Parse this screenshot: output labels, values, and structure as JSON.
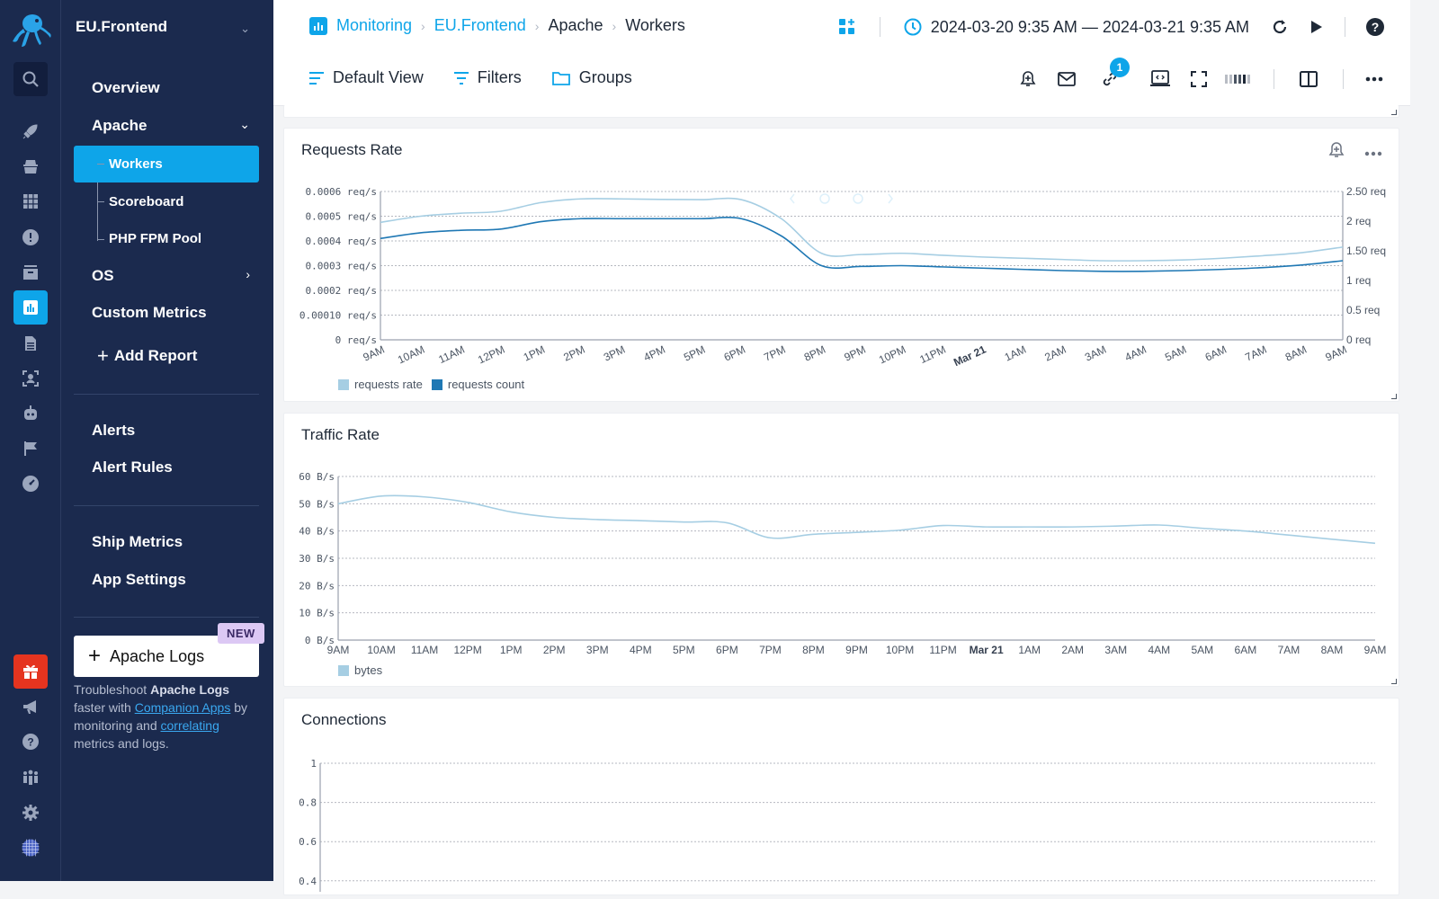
{
  "app": {
    "account": "EU.Frontend"
  },
  "rail": {
    "icons": [
      "logo-octopus",
      "search",
      "rocket",
      "spy",
      "apps-grid",
      "alert",
      "archive",
      "metrics",
      "document",
      "user-scan",
      "robot",
      "flag",
      "dashboard-gauge",
      "gift",
      "megaphone",
      "help",
      "team",
      "settings",
      "avatar-globe"
    ]
  },
  "nav": {
    "items": {
      "overview": "Overview",
      "apache": "Apache",
      "workers": "Workers",
      "scoreboard": "Scoreboard",
      "php_fpm_pool": "PHP FPM Pool",
      "os": "OS",
      "custom_metrics": "Custom Metrics",
      "add_report": "Add Report",
      "alerts": "Alerts",
      "alert_rules": "Alert Rules",
      "ship_metrics": "Ship Metrics",
      "app_settings": "App Settings"
    },
    "logs_button": "Apache Logs",
    "new_badge": "NEW",
    "promo": {
      "t1": "Troubleshoot ",
      "b1": "Apache Logs",
      "t2": " faster with ",
      "link1": "Companion Apps",
      "t3": " by monitoring and ",
      "link2": "correlating",
      "t4": " metrics and logs."
    }
  },
  "header": {
    "breadcrumb": [
      "Monitoring",
      "EU.Frontend",
      "Apache",
      "Workers"
    ],
    "time_range": "2024-03-20 9:35 AM — 2024-03-21 9:35 AM",
    "toolbar": {
      "default_view": "Default View",
      "filters": "Filters",
      "groups": "Groups"
    },
    "link_badge": "1"
  },
  "colors": {
    "accent": "#0ea5e9",
    "sidebar": "#1b2a4e",
    "series_light": "#a6cee3",
    "series_dark": "#1f78b4"
  },
  "chart_data": [
    {
      "type": "line",
      "title": "Requests Rate",
      "x": [
        "9AM",
        "10AM",
        "11AM",
        "12PM",
        "1PM",
        "2PM",
        "3PM",
        "4PM",
        "5PM",
        "6PM",
        "7PM",
        "8PM",
        "9PM",
        "10PM",
        "11PM",
        "Mar 21",
        "1AM",
        "2AM",
        "3AM",
        "4AM",
        "5AM",
        "6AM",
        "7AM",
        "8AM",
        "9AM"
      ],
      "yleft": {
        "ticks": [
          "0 req/s",
          "0.00010 req/s",
          "0.0002 req/s",
          "0.0003 req/s",
          "0.0004 req/s",
          "0.0005 req/s",
          "0.0006 req/s"
        ],
        "range": [
          0,
          0.0006
        ]
      },
      "yright": {
        "ticks": [
          "0 req",
          "0.5 req",
          "1 req",
          "1.50 req",
          "2 req",
          "2.50 req"
        ],
        "range": [
          0,
          2.5
        ]
      },
      "series": [
        {
          "name": "requests rate",
          "axis": "left",
          "values": [
            0.000475,
            0.0005,
            0.000512,
            0.00052,
            0.000555,
            0.00057,
            0.00057,
            0.000568,
            0.000567,
            0.000567,
            0.00049,
            0.00035,
            0.000345,
            0.00035,
            0.000342,
            0.000335,
            0.00033,
            0.000325,
            0.00032,
            0.00032,
            0.000323,
            0.00033,
            0.00034,
            0.000353,
            0.000375
          ]
        },
        {
          "name": "requests count",
          "axis": "left",
          "values": [
            0.00041,
            0.000433,
            0.000443,
            0.000448,
            0.000478,
            0.00049,
            0.00049,
            0.00049,
            0.00049,
            0.00049,
            0.00042,
            0.0003,
            0.000297,
            0.0003,
            0.000295,
            0.00029,
            0.000285,
            0.00028,
            0.000277,
            0.000277,
            0.00028,
            0.000285,
            0.000292,
            0.000303,
            0.00032
          ]
        }
      ],
      "legend": [
        "requests rate",
        "requests count"
      ],
      "grid": true,
      "legend_position": "bottom-left"
    },
    {
      "type": "line",
      "title": "Traffic Rate",
      "x": [
        "9AM",
        "10AM",
        "11AM",
        "12PM",
        "1PM",
        "2PM",
        "3PM",
        "4PM",
        "5PM",
        "6PM",
        "7PM",
        "8PM",
        "9PM",
        "10PM",
        "11PM",
        "Mar 21",
        "1AM",
        "2AM",
        "3AM",
        "4AM",
        "5AM",
        "6AM",
        "7AM",
        "8AM",
        "9AM"
      ],
      "yleft": {
        "ticks": [
          "0 B/s",
          "10 B/s",
          "20 B/s",
          "30 B/s",
          "40 B/s",
          "50 B/s",
          "60 B/s"
        ],
        "range": [
          0,
          60
        ]
      },
      "series": [
        {
          "name": "bytes",
          "values": [
            50,
            52.8,
            52.5,
            50.5,
            47,
            45,
            44.2,
            43.8,
            43.3,
            43,
            37.5,
            38.8,
            39.5,
            40.3,
            42,
            41.5,
            41.5,
            41.5,
            41.8,
            42.2,
            41,
            40,
            38.5,
            37,
            35.5
          ]
        }
      ],
      "legend": [
        "bytes"
      ],
      "grid": true,
      "legend_position": "bottom-left"
    },
    {
      "type": "line",
      "title": "Connections",
      "yleft": {
        "ticks": [
          "0.4",
          "0.6",
          "0.8",
          "1"
        ],
        "range": [
          0,
          1
        ]
      },
      "series": [],
      "grid": true
    }
  ]
}
